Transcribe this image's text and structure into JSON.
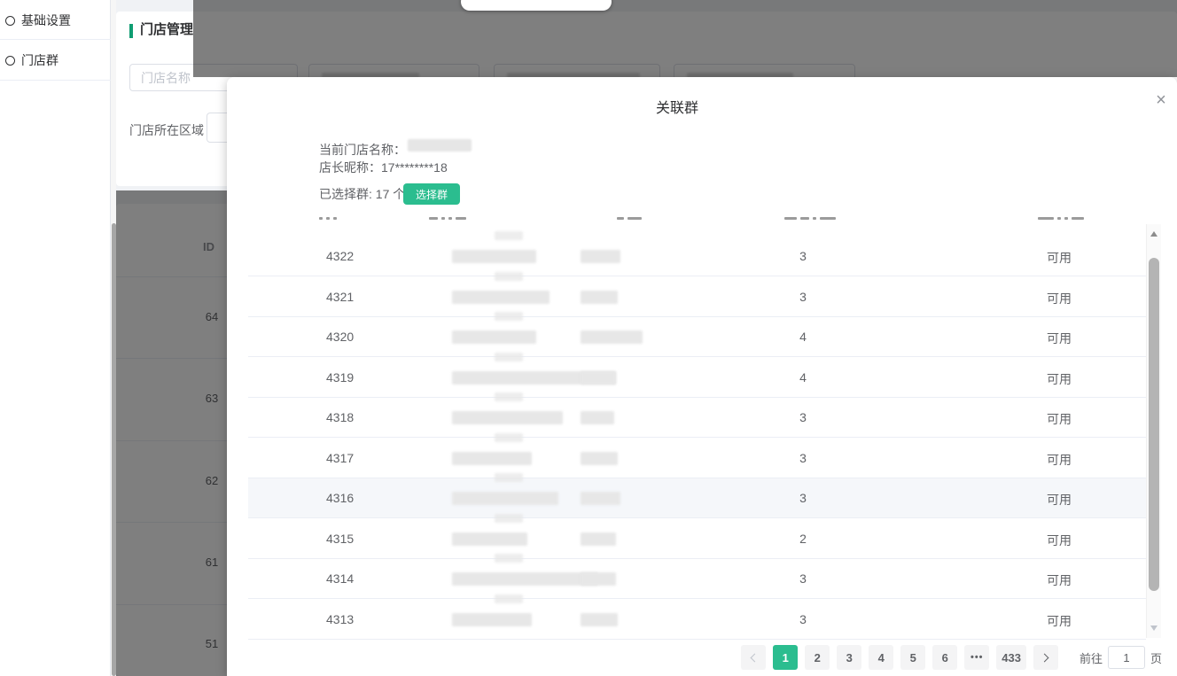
{
  "colors": {
    "accent": "#2bbd8f",
    "title_marker": "#0f9d72"
  },
  "page": {
    "sidebar": {
      "items": [
        {
          "label": "基础设置"
        },
        {
          "label": "门店群"
        }
      ]
    },
    "main": {
      "title": "门店管理",
      "filters": {
        "store_name_placeholder": "门店名称",
        "region_label": "门店所在区域"
      },
      "table": {
        "id_header": "ID",
        "row_ids": [
          "64",
          "63",
          "62",
          "61",
          "51"
        ]
      }
    }
  },
  "modal": {
    "title": "关联群",
    "close_icon": "×",
    "info": {
      "store_name_label": "当前门店名称：",
      "manager_label": "店长昵称：",
      "manager_value": "17********18",
      "selected_label": "已选择群: 17 个",
      "select_button": "选择群"
    },
    "table": {
      "rows": [
        {
          "id": "4322",
          "count": "3",
          "status": "可用",
          "name_blur_w": 95,
          "owner_blur_w": 45
        },
        {
          "id": "4321",
          "count": "3",
          "status": "可用",
          "name_blur_w": 110,
          "owner_blur_w": 42
        },
        {
          "id": "4320",
          "count": "4",
          "status": "可用",
          "name_blur_w": 95,
          "owner_blur_w": 70
        },
        {
          "id": "4319",
          "count": "4",
          "status": "可用",
          "name_blur_w": 185,
          "owner_blur_w": 40
        },
        {
          "id": "4318",
          "count": "3",
          "status": "可用",
          "name_blur_w": 125,
          "owner_blur_w": 38
        },
        {
          "id": "4317",
          "count": "3",
          "status": "可用",
          "name_blur_w": 90,
          "owner_blur_w": 42
        },
        {
          "id": "4316",
          "count": "3",
          "status": "可用",
          "name_blur_w": 120,
          "owner_blur_w": 45
        },
        {
          "id": "4315",
          "count": "2",
          "status": "可用",
          "name_blur_w": 85,
          "owner_blur_w": 40
        },
        {
          "id": "4314",
          "count": "3",
          "status": "可用",
          "name_blur_w": 165,
          "owner_blur_w": 40
        },
        {
          "id": "4313",
          "count": "3",
          "status": "可用",
          "name_blur_w": 90,
          "owner_blur_w": 42
        }
      ]
    },
    "pagination": {
      "pages": [
        "1",
        "2",
        "3",
        "4",
        "5",
        "6"
      ],
      "more": "•••",
      "last_page": "433",
      "active_page": "1",
      "goto_label": "前往",
      "goto_value": "1",
      "goto_unit": "页"
    }
  }
}
